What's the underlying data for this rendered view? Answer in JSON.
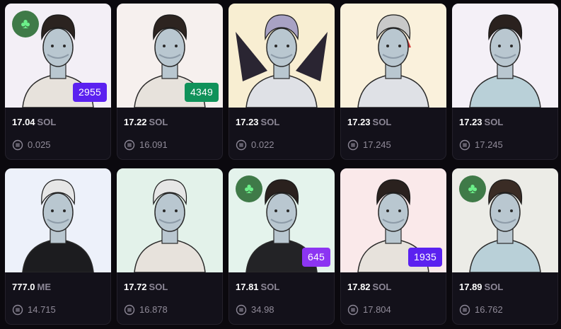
{
  "colors": {
    "background": "#0b090e",
    "card": "#13111a",
    "rank_purple": "#5b21f0",
    "rank_violet": "#8c35f2",
    "rank_green": "#10925a",
    "clover_badge": "#3f7a48"
  },
  "fee_icon": "coin-stack-icon",
  "clover_icon": "clover-icon",
  "listings": [
    {
      "bg": "#f3eff6",
      "hair": "#2b2320",
      "badge": true,
      "rank": "2955",
      "rank_color": "#5b21f0",
      "price": "17.04",
      "currency": "SOL",
      "fee": "0.025"
    },
    {
      "bg": "#f6f0ee",
      "hair": "#2d2420",
      "badge": false,
      "rank": "4349",
      "rank_color": "#10925a",
      "price": "17.22",
      "currency": "SOL",
      "fee": "16.091"
    },
    {
      "bg": "#f8eed2",
      "hair": "#a8a2c4",
      "badge": false,
      "rank": "",
      "rank_color": "",
      "price": "17.23",
      "currency": "SOL",
      "fee": "0.022"
    },
    {
      "bg": "#faf1dc",
      "hair": "#c9c9c9",
      "badge": false,
      "rank": "",
      "rank_color": "",
      "price": "17.23",
      "currency": "SOL",
      "fee": "17.245"
    },
    {
      "bg": "#f4f0f7",
      "hair": "#2a211e",
      "badge": false,
      "rank": "",
      "rank_color": "",
      "price": "17.23",
      "currency": "SOL",
      "fee": "17.245"
    },
    {
      "bg": "#edf1fa",
      "hair": "#e6e6e6",
      "badge": false,
      "rank": "",
      "rank_color": "",
      "price": "777.0",
      "currency": "ME",
      "fee": "14.715"
    },
    {
      "bg": "#e3f2ea",
      "hair": "#e6e6e6",
      "badge": false,
      "rank": "",
      "rank_color": "",
      "price": "17.72",
      "currency": "SOL",
      "fee": "16.878"
    },
    {
      "bg": "#e4f3ec",
      "hair": "#2a211e",
      "badge": true,
      "rank": "645",
      "rank_color": "#8c35f2",
      "price": "17.81",
      "currency": "SOL",
      "fee": "34.98"
    },
    {
      "bg": "#fae9ea",
      "hair": "#2a211e",
      "badge": false,
      "rank": "1935",
      "rank_color": "#5b21f0",
      "price": "17.82",
      "currency": "SOL",
      "fee": "17.804"
    },
    {
      "bg": "#ecece7",
      "hair": "#3a2c25",
      "badge": true,
      "rank": "",
      "rank_color": "",
      "price": "17.89",
      "currency": "SOL",
      "fee": "16.762"
    }
  ]
}
